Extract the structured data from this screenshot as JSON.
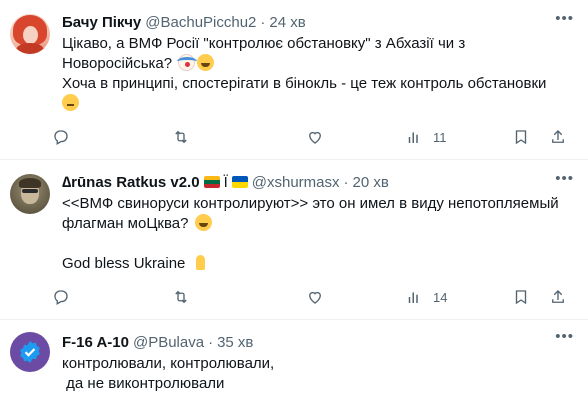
{
  "tweets": [
    {
      "name": "Бачу Пікчу",
      "handle": "@BachuPicchu2",
      "separator": "·",
      "time": "24 хв",
      "lines": [
        "Цікаво, а ВМФ Росії \"контролює обстановку\" з Абхазії чи з",
        "Новоросійська?",
        "Хоча в принципі, спостерігати в бінокль - це теж контроль обстановки"
      ],
      "emojis": [
        "clown-face-icon",
        "squinting-laugh-icon",
        "neutral-face-icon"
      ],
      "views": "11"
    },
    {
      "name": "∆rūnas Ratkus v2.0",
      "name_extra": "Ї",
      "handle": "@xshurmasx",
      "separator": "·",
      "time": "20 хв",
      "flags": [
        "lithuania-flag-icon",
        "ukraine-flag-icon"
      ],
      "lines": [
        "<<ВМФ свиноруси контролируют>>  это он имел в виду  непотопляемый",
        "флагман моЦква?",
        "God bless Ukraine"
      ],
      "emojis": [
        "grinning-squint-icon",
        "praying-hands-icon"
      ],
      "views": "14"
    },
    {
      "name": "F-16 A-10",
      "handle": "@PBulava",
      "separator": "·",
      "time": "35 хв",
      "lines": [
        "контролювали, контролювали,",
        " да не виконтролювали"
      ]
    }
  ],
  "colors": {
    "text": "#0f1419",
    "secondary": "#536471",
    "divider": "#eff3f4",
    "verified": "#1d9bf0"
  }
}
